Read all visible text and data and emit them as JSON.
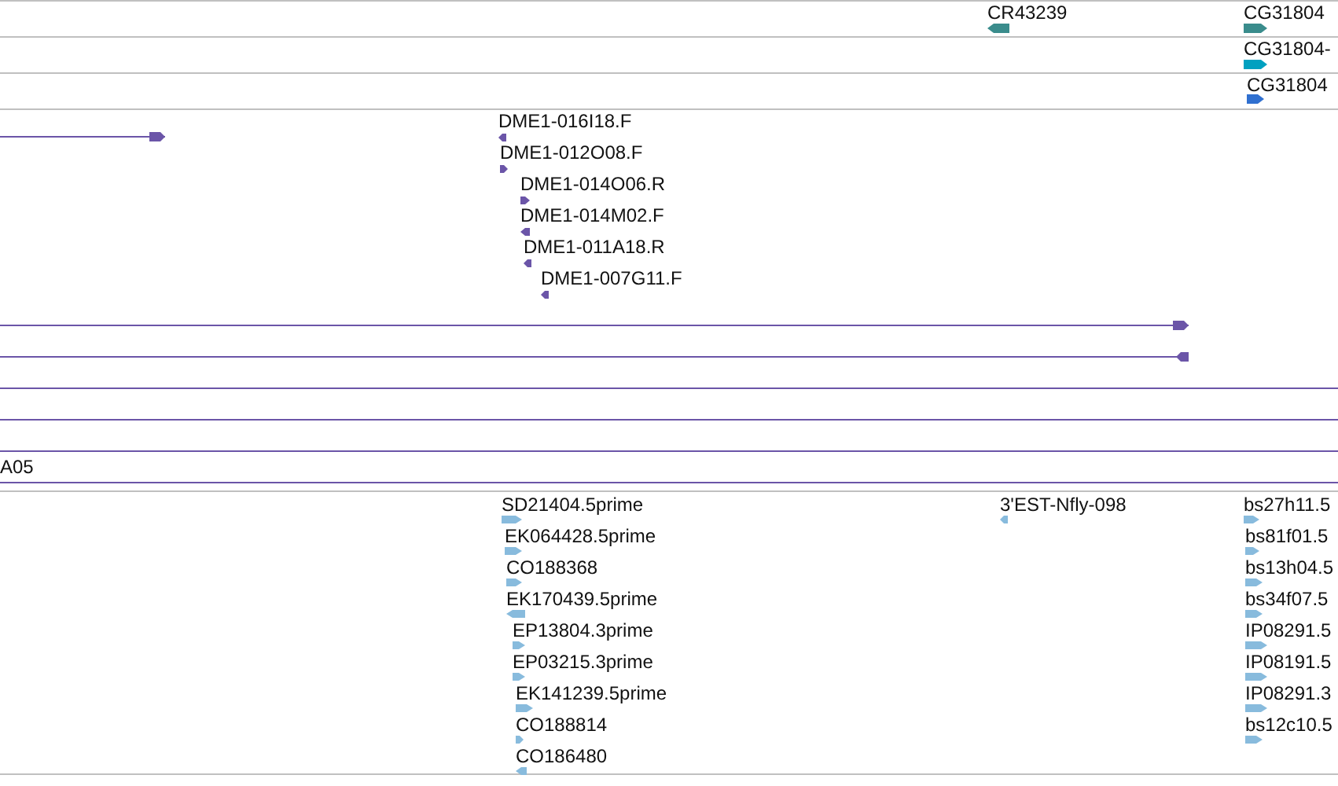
{
  "tracks": [
    {
      "features": [
        {
          "kind": "gene",
          "label": "CR43239",
          "reverse": true,
          "color": "#3a8c8c"
        },
        {
          "kind": "gene",
          "label": "CG31804",
          "reverse": false,
          "color": "#3a8c8c"
        }
      ]
    },
    {
      "features": [
        {
          "kind": "gene",
          "label": "CG31804-",
          "reverse": false,
          "color": "#00a0c0"
        }
      ]
    },
    {
      "features": [
        {
          "kind": "gene",
          "label": "CG31804",
          "reverse": false,
          "color": "#3070d0"
        }
      ]
    },
    {
      "features": [
        {
          "kind": "span",
          "reverse": false
        },
        {
          "kind": "read",
          "label": "DME1-016I18.F",
          "reverse": true
        },
        {
          "kind": "read",
          "label": "DME1-012O08.F",
          "reverse": false
        },
        {
          "kind": "read",
          "label": "DME1-014O06.R",
          "reverse": false
        },
        {
          "kind": "read",
          "label": "DME1-014M02.F",
          "reverse": true
        },
        {
          "kind": "read",
          "label": "DME1-011A18.R",
          "reverse": true
        },
        {
          "kind": "read",
          "label": "DME1-007G11.F",
          "reverse": true
        },
        {
          "kind": "span",
          "reverse": false
        },
        {
          "kind": "span",
          "reverse": true
        },
        {
          "kind": "rule"
        },
        {
          "kind": "rule"
        },
        {
          "kind": "rule"
        },
        {
          "kind": "rule",
          "label": "A05"
        }
      ]
    },
    {
      "features": [
        {
          "kind": "read",
          "label": "SD21404.5prime",
          "reverse": false
        },
        {
          "kind": "read",
          "label": "EK064428.5prime",
          "reverse": false
        },
        {
          "kind": "read",
          "label": "CO188368",
          "reverse": false
        },
        {
          "kind": "read",
          "label": "EK170439.5prime",
          "reverse": true
        },
        {
          "kind": "read",
          "label": "EP13804.3prime",
          "reverse": false
        },
        {
          "kind": "read",
          "label": "EP03215.3prime",
          "reverse": false
        },
        {
          "kind": "read",
          "label": "EK141239.5prime",
          "reverse": false
        },
        {
          "kind": "read",
          "label": "CO188814",
          "reverse": false
        },
        {
          "kind": "read",
          "label": "CO186480",
          "reverse": true
        },
        {
          "kind": "read",
          "label": "3'EST-Nfly-098",
          "reverse": true
        },
        {
          "kind": "read",
          "label": "bs27h11.5",
          "reverse": false
        },
        {
          "kind": "read",
          "label": "bs81f01.5",
          "reverse": false
        },
        {
          "kind": "read",
          "label": "bs13h04.5",
          "reverse": false
        },
        {
          "kind": "read",
          "label": "bs34f07.5",
          "reverse": false
        },
        {
          "kind": "read",
          "label": "IP08291.5",
          "reverse": false
        },
        {
          "kind": "read",
          "label": "IP08191.5",
          "reverse": false
        },
        {
          "kind": "read",
          "label": "IP08291.3",
          "reverse": false
        },
        {
          "kind": "read",
          "label": "bs12c10.5",
          "reverse": false
        }
      ]
    }
  ]
}
